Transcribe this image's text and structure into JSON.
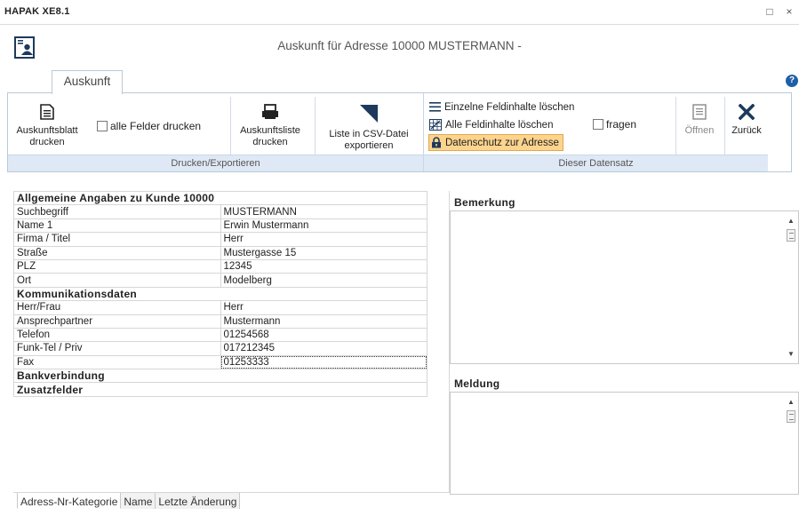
{
  "window": {
    "title": "HAPAK XE8.1",
    "maximize_glyph": "□",
    "close_glyph": "×"
  },
  "header": {
    "title": "Auskunft für Adresse 10000 MUSTERMANN -",
    "icon": "address-card-icon"
  },
  "tabs": [
    {
      "label": "Auskunft",
      "active": true
    }
  ],
  "help_glyph": "?",
  "ribbon": {
    "groups": [
      {
        "label": "Drucken/Exportieren",
        "buttons": {
          "auskunftsblatt": "Auskunftsblatt\ndrucken",
          "alle_felder": "alle Felder drucken",
          "auskunftsliste": "Auskunftsliste\ndrucken",
          "csv": "Liste in CSV-Datei\nexportieren"
        }
      },
      {
        "label": "Dieser Datensatz",
        "buttons": {
          "einzelne": "Einzelne Feldinhalte löschen",
          "alle": "Alle Feldinhalte löschen",
          "fragen": "fragen",
          "datenschutz": "Datenschutz zur Adresse",
          "oeffnen": "Öffnen",
          "zurueck": "Zurück"
        }
      }
    ]
  },
  "grid": {
    "rows": [
      {
        "section": true,
        "label": "Allgemeine Angaben zu Kunde 10000"
      },
      {
        "label": "Suchbegriff",
        "value": "MUSTERMANN"
      },
      {
        "label": "Name 1",
        "value": "Erwin Mustermann"
      },
      {
        "label": "Firma / Titel",
        "value": "Herr"
      },
      {
        "label": "Straße",
        "value": "Mustergasse 15"
      },
      {
        "label": "PLZ",
        "value": "12345"
      },
      {
        "label": "Ort",
        "value": "Modelberg"
      },
      {
        "section": true,
        "label": "Kommunikationsdaten"
      },
      {
        "label": "Herr/Frau",
        "value": "Herr"
      },
      {
        "label": "Ansprechpartner",
        "value": "Mustermann"
      },
      {
        "label": "Telefon",
        "value": "01254568"
      },
      {
        "label": "Funk-Tel / Priv",
        "value": "017212345"
      },
      {
        "label": "Fax",
        "value": "01253333",
        "focused": true
      },
      {
        "section": true,
        "label": "Bankverbindung"
      },
      {
        "section": true,
        "label": "Zusatzfelder"
      }
    ]
  },
  "right": {
    "bemerkung_label": "Bemerkung",
    "bemerkung_value": "",
    "meldung_label": "Meldung",
    "meldung_value": ""
  },
  "bottom_tabs": [
    "Adress-Nr-Kategorie",
    "Name",
    "Letzte Änderung"
  ]
}
